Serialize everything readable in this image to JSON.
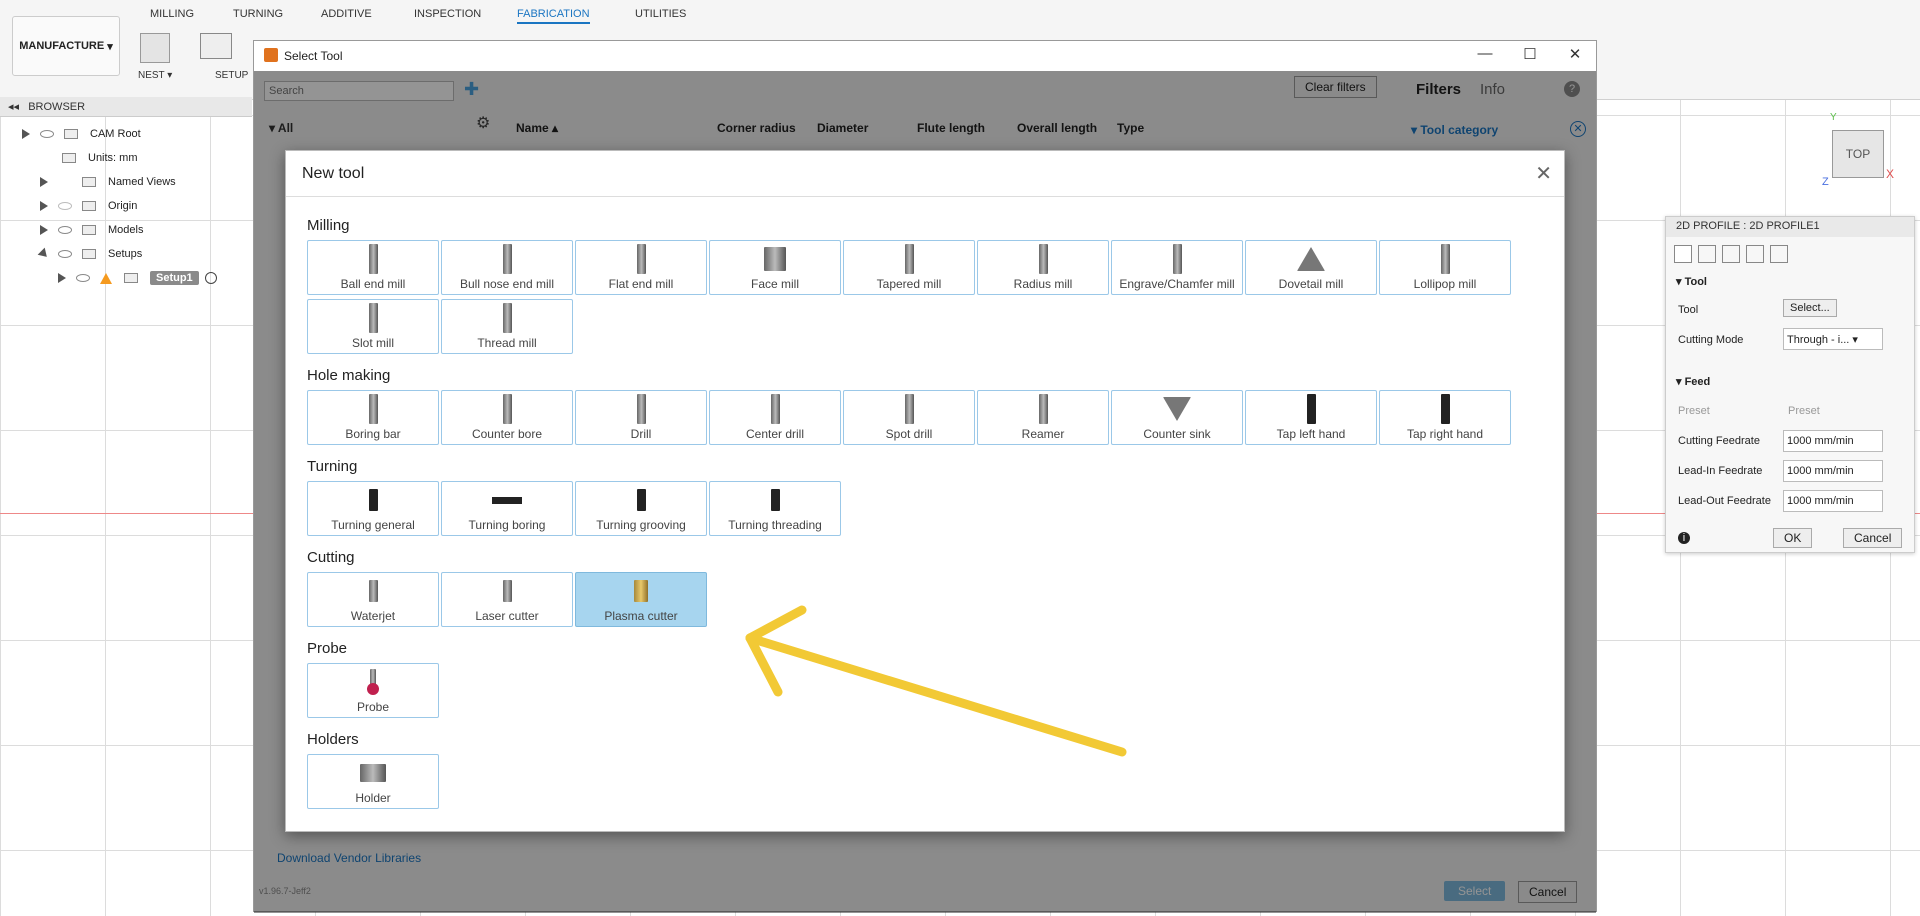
{
  "ribbon": {
    "workspace": "MANUFACTURE",
    "tabs": [
      "MILLING",
      "TURNING",
      "ADDITIVE",
      "INSPECTION",
      "FABRICATION",
      "UTILITIES"
    ],
    "active_tab": "FABRICATION",
    "nest_label": "NEST",
    "setup_label": "SETUP"
  },
  "browser": {
    "title": "BROWSER",
    "items": [
      {
        "label": "CAM Root"
      },
      {
        "label": "Units: mm"
      },
      {
        "label": "Named Views"
      },
      {
        "label": "Origin"
      },
      {
        "label": "Models"
      },
      {
        "label": "Setups"
      },
      {
        "label": "Setup1"
      }
    ]
  },
  "select_tool": {
    "title": "Select Tool",
    "search_placeholder": "Search",
    "tree_all": "All",
    "columns": [
      "Name",
      "Corner radius",
      "Diameter",
      "Flute length",
      "Overall length",
      "Type"
    ],
    "clear_filters": "Clear filters",
    "filters_tab": "Filters",
    "info_tab": "Info",
    "tool_category": "Tool category",
    "download_vendor": "Download Vendor Libraries",
    "version": "v1.96.7-Jeff2",
    "select_button": "Select",
    "cancel_button": "Cancel"
  },
  "new_tool": {
    "title": "New tool",
    "categories": [
      {
        "name": "Milling",
        "tools": [
          "Ball end mill",
          "Bull nose end mill",
          "Flat end mill",
          "Face mill",
          "Tapered mill",
          "Radius mill",
          "Engrave/Chamfer mill",
          "Dovetail mill",
          "Lollipop mill",
          "Slot mill",
          "Thread mill"
        ]
      },
      {
        "name": "Hole making",
        "tools": [
          "Boring bar",
          "Counter bore",
          "Drill",
          "Center drill",
          "Spot drill",
          "Reamer",
          "Counter sink",
          "Tap left hand",
          "Tap right hand"
        ]
      },
      {
        "name": "Turning",
        "tools": [
          "Turning general",
          "Turning boring",
          "Turning grooving",
          "Turning threading"
        ]
      },
      {
        "name": "Cutting",
        "tools": [
          "Waterjet",
          "Laser cutter",
          "Plasma cutter"
        ]
      },
      {
        "name": "Probe",
        "tools": [
          "Probe"
        ]
      },
      {
        "name": "Holders",
        "tools": [
          "Holder"
        ]
      }
    ],
    "selected_tool": "Plasma cutter"
  },
  "profile_panel": {
    "title": "2D PROFILE : 2D PROFILE1",
    "tool_section": "Tool",
    "tool_label": "Tool",
    "tool_button": "Select...",
    "cutting_mode_label": "Cutting Mode",
    "cutting_mode_value": "Through - i...",
    "feed_section": "Feed",
    "preset_label": "Preset",
    "preset_value": "Preset",
    "cutting_feedrate_label": "Cutting Feedrate",
    "cutting_feedrate_value": "1000 mm/min",
    "leadin_label": "Lead-In Feedrate",
    "leadin_value": "1000 mm/min",
    "leadout_label": "Lead-Out Feedrate",
    "leadout_value": "1000 mm/min",
    "ok": "OK",
    "cancel": "Cancel"
  },
  "viewcube": {
    "face": "TOP",
    "x": "X",
    "y": "Y",
    "z": "Z"
  },
  "annotation_color": "#f2c935"
}
